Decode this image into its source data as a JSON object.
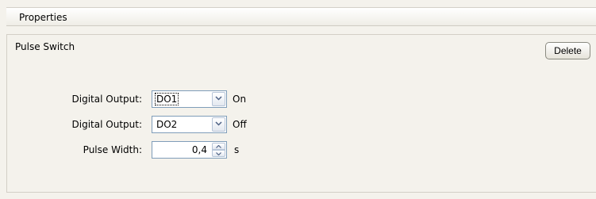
{
  "header": {
    "title": "Properties"
  },
  "panel": {
    "title": "Pulse Switch",
    "delete_label": "Delete"
  },
  "rows": [
    {
      "label": "Digital Output:",
      "value": "DO1",
      "state": "On",
      "icon": "chevron-down-icon"
    },
    {
      "label": "Digital Output:",
      "value": "DO2",
      "state": "Off",
      "icon": "chevron-down-icon"
    }
  ],
  "pulse": {
    "label": "Pulse Width:",
    "value": "0,4",
    "unit": "s",
    "icons": [
      "spin-up-icon",
      "spin-down-icon"
    ]
  },
  "colors": {
    "background": "#f4f2ec",
    "input_border": "#7f9db9",
    "button_border": "#8a8a80"
  }
}
